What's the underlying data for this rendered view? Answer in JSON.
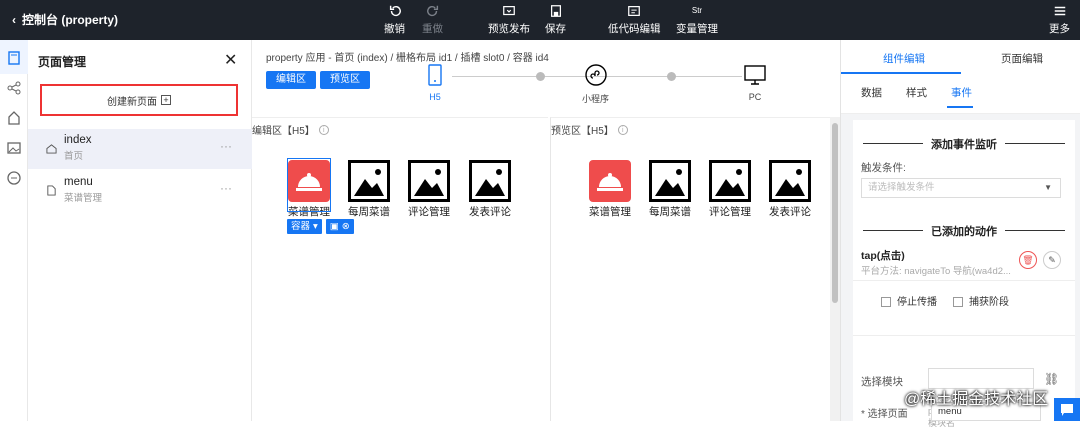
{
  "topbar": {
    "back_label": "控制台 (property)",
    "buttons": {
      "undo": "撤销",
      "redo": "重做",
      "preview_publish": "预览发布",
      "save": "保存",
      "lowcode": "低代码编辑",
      "vars": "变量管理",
      "more": "更多"
    },
    "vars_icon_text": "Str"
  },
  "pages_panel": {
    "title": "页面管理",
    "create_button": "创建新页面",
    "items": [
      {
        "name": "index",
        "subtitle": "首页"
      },
      {
        "name": "menu",
        "subtitle": "菜谱管理"
      }
    ]
  },
  "main": {
    "breadcrumb": "property 应用 - 首页 (index)  /  栅格布局 id1  /  插槽 slot0  /  容器 id4",
    "edit_button": "编辑区",
    "preview_button": "预览区",
    "devices": {
      "h5": "H5",
      "mini": "小程序",
      "pc": "PC"
    },
    "edit_area_title": "编辑区【H5】",
    "preview_area_title": "预览区【H5】",
    "tiles": [
      "菜谱管理",
      "每周菜谱",
      "评论管理",
      "发表评论"
    ],
    "selection_tag": "容器"
  },
  "right_panel": {
    "tabs": [
      "组件编辑",
      "页面编辑"
    ],
    "subtabs": [
      "数据",
      "样式",
      "事件"
    ],
    "add_listener_title": "添加事件监听",
    "trigger_label": "触发条件:",
    "trigger_placeholder": "请选择触发条件",
    "added_actions_title": "已添加的动作",
    "action_name": "tap(点击)",
    "action_desc": "平台方法: navigateTo 导航(wa4d2...",
    "stop_propagation": "停止传播",
    "capture_phase": "捕获阶段",
    "select_module_label": "选择模块",
    "module_hint": "主模块为空，子模块为 packages/xxx, 其中xxx为子模块名",
    "select_page_label": "* 选择页面",
    "select_page_value": "menu"
  },
  "watermark": "@稀土掘金技术社区",
  "colors": {
    "topbar": "#1e232b",
    "accent": "#1676f3",
    "highlight": "#ee3333",
    "tile_red": "#ef4c4c"
  }
}
